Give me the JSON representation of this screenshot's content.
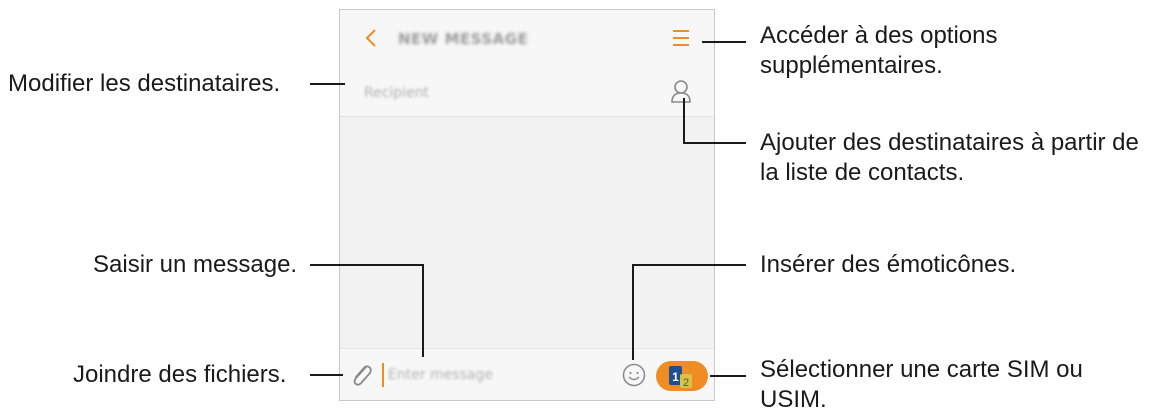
{
  "phone": {
    "app_title": "NEW MESSAGE",
    "recipient_placeholder": "Recipient",
    "message_placeholder": "Enter message",
    "sim_labels": [
      "1",
      "2"
    ],
    "icons": [
      "back-arrow-icon",
      "more-options-icon",
      "contact-icon",
      "attach-clip-icon",
      "emoji-icon",
      "sim-card-icon"
    ],
    "accent_color": "#ef8c24"
  },
  "callouts": {
    "more_options": [
      "Accéder à des options",
      "supplémentaires."
    ],
    "edit_recipients": "Modifier les destinataires.",
    "add_from_contacts": [
      "Ajouter des destinataires à partir de",
      "la liste de contacts."
    ],
    "type_message": "Saisir un message.",
    "insert_emoticons": "Insérer des émoticônes.",
    "attach_files": "Joindre des fichiers.",
    "select_sim": [
      "Sélectionner une carte SIM ou",
      "USIM."
    ]
  }
}
